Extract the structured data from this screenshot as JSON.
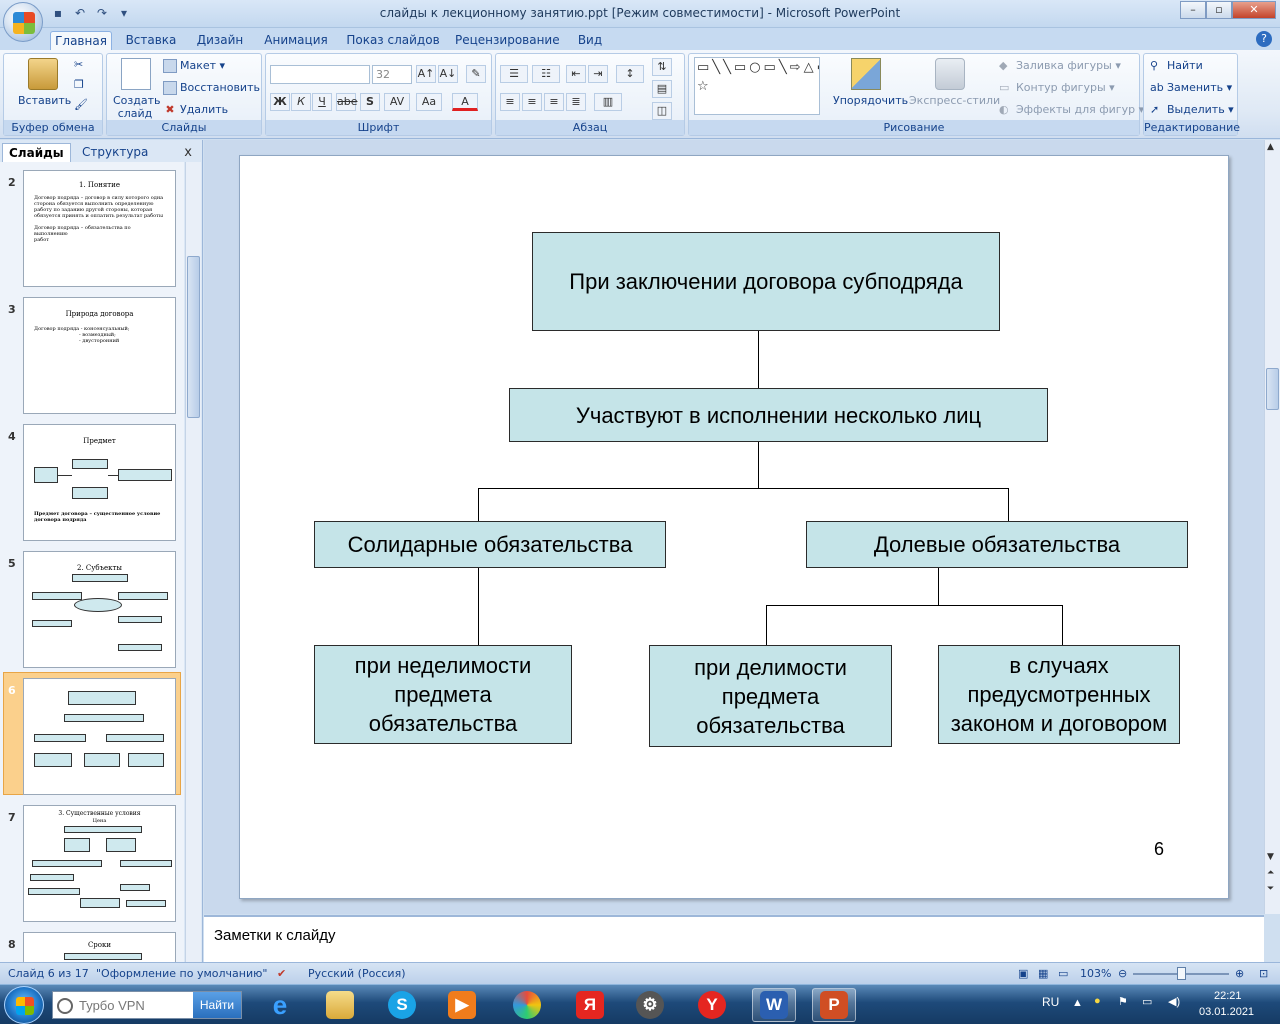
{
  "window": {
    "title": "слайды к лекционному занятию.ppt [Режим совместимости] - Microsoft PowerPoint"
  },
  "ribbon_tabs": [
    "Главная",
    "Вставка",
    "Дизайн",
    "Анимация",
    "Показ слайдов",
    "Рецензирование",
    "Вид"
  ],
  "ribbon": {
    "clipboard": {
      "paste": "Вставить",
      "label": "Буфер обмена"
    },
    "slides": {
      "new_slide": "Создать слайд",
      "layout": "Макет",
      "reset": "Восстановить",
      "delete": "Удалить",
      "label": "Слайды"
    },
    "font": {
      "size": "32",
      "label": "Шрифт",
      "bold": "Ж",
      "italic": "К",
      "underline": "Ч",
      "strike": "abe",
      "shadow": "S",
      "spacing": "AV",
      "case": "Aa",
      "color": "A"
    },
    "paragraph": {
      "label": "Абзац"
    },
    "drawing": {
      "arrange": "Упорядочить",
      "quick_styles": "Экспресс-стили",
      "fill": "Заливка фигуры",
      "outline": "Контур фигуры",
      "effects": "Эффекты для фигур",
      "label": "Рисование"
    },
    "editing": {
      "find": "Найти",
      "replace": "Заменить",
      "select": "Выделить",
      "label": "Редактирование"
    }
  },
  "panel": {
    "tabs": [
      "Слайды",
      "Структура"
    ],
    "close": "x"
  },
  "thumbnails": [
    {
      "num": "2",
      "title": "1. Понятие",
      "lines": [
        "Договор подряда – договор в силу которого одна",
        "сторона обязуется выполнить определенную",
        "работу по заданию другой стороны, которая",
        "обязуется принять и оплатить результат работы",
        "",
        "Договор подряда – обязательства по выполнению",
        "работ"
      ]
    },
    {
      "num": "3",
      "title": "Природа договора",
      "lines": [
        "Договор подряда - консенсуальный;",
        "- возмездный;",
        "- двусторонний"
      ]
    },
    {
      "num": "4",
      "title": "Предмет",
      "lines": [
        "Предмет договора – существенное условие",
        "договора подряда"
      ]
    },
    {
      "num": "5",
      "title": "2. Субъекты",
      "lines": []
    },
    {
      "num": "6",
      "title": "",
      "lines": []
    },
    {
      "num": "7",
      "title": "3. Существенные условия",
      "lines": [
        "Цена"
      ]
    },
    {
      "num": "8",
      "title": "Сроки",
      "lines": []
    }
  ],
  "slide": {
    "top_box": "При заключении договора субподряда",
    "middle_box": "Участвуют в исполнении несколько лиц",
    "left_box": "Солидарные обязательства",
    "right_box": "Долевые обязательства",
    "leaf_1": "при неделимости предмета обязательства",
    "leaf_2": "при делимости предмета обязательства",
    "leaf_3": "в случаях предусмотренных законом и договором",
    "number": "6"
  },
  "notes": {
    "placeholder": "Заметки к слайду"
  },
  "status": {
    "slide_info": "Слайд 6 из 17",
    "theme": "\"Оформление по умолчанию\"",
    "language": "Русский (Россия)",
    "zoom": "103%"
  },
  "taskbar": {
    "vpn_placeholder": "Турбо VPN",
    "vpn_button": "Найти",
    "lang": "RU",
    "time": "22:21",
    "date": "03.01.2021"
  }
}
